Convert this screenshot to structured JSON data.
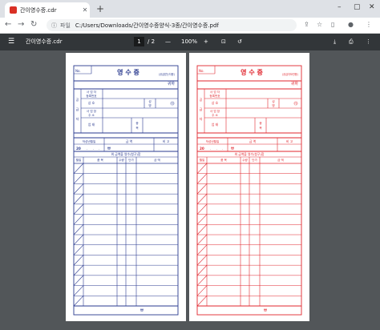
{
  "browser": {
    "tab_title": "간이영수증.cdr",
    "new_tab": "+",
    "min": "–",
    "max": "▢",
    "close": "✕",
    "address_label": "파일",
    "address": "C:/Users/Downloads/간이영수증양식-3종/간이영수증.pdf"
  },
  "pdf_toolbar": {
    "title": "간이영수증.cdr",
    "page_current": "1",
    "page_total": "/ 2",
    "zoom_minus": "—",
    "zoom": "100%",
    "zoom_plus": "+"
  },
  "receipt": {
    "title": "영 수 증",
    "no_label": "No.",
    "copy_blue": "(공급받는자용)",
    "copy_red": "(공급자보관용)",
    "honorific": "귀하",
    "side_label": "공급자",
    "reg_no": "사 업 자\n등록번호",
    "company": "상 호",
    "name": "성 명",
    "seal": "㊞",
    "address": "사 업 장\n주 소",
    "business": "업 태",
    "item_type": "종 목",
    "col_date": "작성년월일",
    "col_amount": "금 액",
    "col_note": "비 고",
    "date_prefix": "20",
    "currency": "₩",
    "confirm": "위 금액을 영수(청구)함",
    "table_headers": [
      "월일",
      "품 목",
      "수량",
      "단가",
      "금 액"
    ],
    "total_currency": "₩"
  },
  "colors": {
    "blue": "#2a3a8f",
    "red": "#e0262e"
  }
}
